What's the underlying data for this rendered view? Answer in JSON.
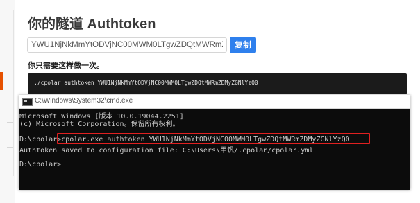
{
  "page": {
    "title": "你的隧道 Authtoken",
    "token_value": "YWU1NjNkMmYtODVjNC00MWM0LTgwZDQtMWRmZDMyZGNlYzQ0",
    "copy_label": "复制",
    "once_note": "你只需要这样做一次。",
    "command": "./cpolar authtoken YWU1NjNkMmYtODVjNC00MWM0LTgwZDQtMWRmZDMyZGNlYzQ0"
  },
  "cmd": {
    "window_title": "C:\\Windows\\System32\\cmd.exe",
    "lines": [
      "Microsoft Windows [版本 10.0.19044.2251]",
      "(c) Microsoft Corporation。保留所有权利。",
      "",
      "D:\\cpolar>cpolar.exe authtoken YWU1NjNkMmYtODVjNC00MWM0LTgwZDQtMWRmZDMyZGNlYzQ0",
      "Authtoken saved to configuration file: C:\\Users\\甲钒/.cpolar/cpolar.yml",
      "",
      "D:\\cpolar>"
    ]
  },
  "colors": {
    "accent": "#2f80ed",
    "highlight": "#e02020",
    "terminal_bg": "#0c0c0c",
    "terminal_fg": "#cccccc",
    "sidebar_marker": "#e65100"
  },
  "icons": {
    "cmd": "cmd-window-icon"
  }
}
